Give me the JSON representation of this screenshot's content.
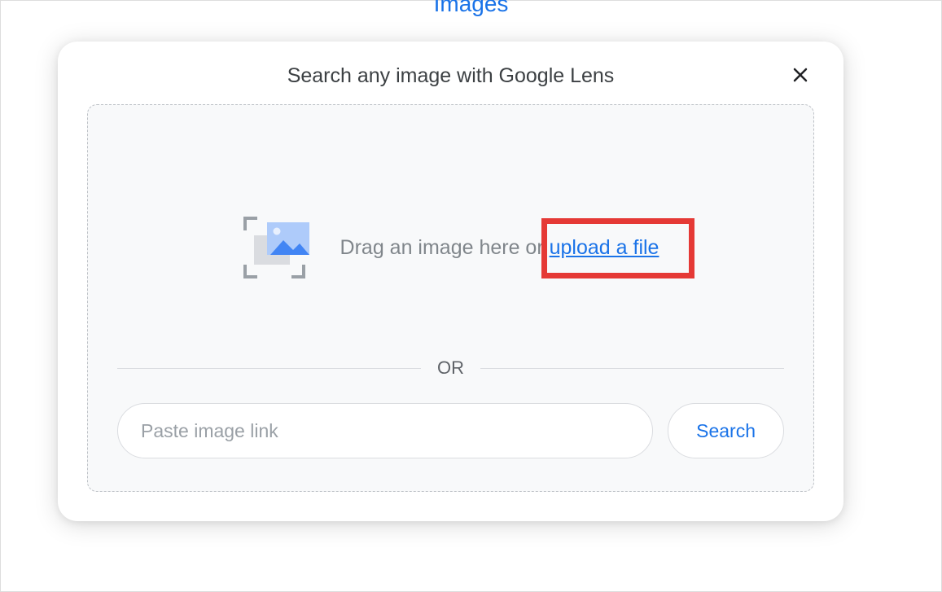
{
  "background": {
    "partial_text": "Images"
  },
  "modal": {
    "title": "Search any image with Google Lens",
    "drop_prefix": "Drag an image here or ",
    "upload_link": "upload a file",
    "or_label": "OR",
    "link_placeholder": "Paste image link",
    "search_label": "Search",
    "colors": {
      "link_blue": "#1a73e8",
      "highlight_red": "#e53935",
      "text_gray": "#80868b",
      "border_gray": "#dadce0"
    }
  }
}
